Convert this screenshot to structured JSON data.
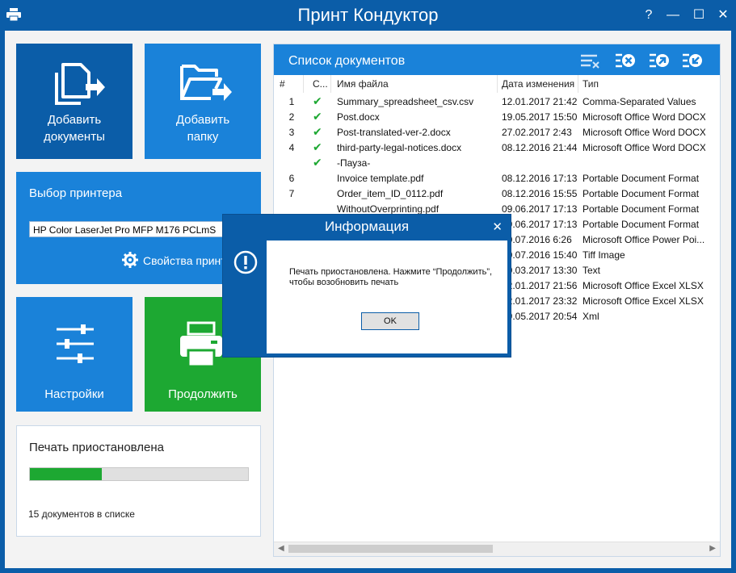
{
  "window": {
    "title": "Принт Кондуктор",
    "help_label": "?",
    "min_label": "—",
    "max_label": "☐",
    "close_label": "✕"
  },
  "tiles": {
    "add_documents": "Добавить документы",
    "add_documents_line1": "Добавить",
    "add_documents_line2": "документы",
    "add_folder_line1": "Добавить",
    "add_folder_line2": "папку",
    "settings": "Настройки",
    "continue": "Продолжить"
  },
  "printer": {
    "title": "Выбор принтера",
    "selected": "HP Color LaserJet Pro MFP M176 PCLmS",
    "properties_label": "Свойства принтера"
  },
  "status": {
    "title": "Печать приостановлена",
    "progress_percent": 33,
    "count_text": "15 документов в списке"
  },
  "doclist": {
    "title": "Список документов",
    "columns": {
      "num": "#",
      "status": "С...",
      "name": "Имя файла",
      "date": "Дата изменения",
      "type": "Тип"
    },
    "rows": [
      {
        "num": "1",
        "check": "✔",
        "name": "Summary_spreadsheet_csv.csv",
        "date": "12.01.2017 21:42",
        "type": "Comma-Separated Values"
      },
      {
        "num": "2",
        "check": "✔",
        "name": "Post.docx",
        "date": "19.05.2017 15:50",
        "type": "Microsoft Office Word DOCX"
      },
      {
        "num": "3",
        "check": "✔",
        "name": "Post-translated-ver-2.docx",
        "date": "27.02.2017 2:43",
        "type": "Microsoft Office Word DOCX"
      },
      {
        "num": "4",
        "check": "✔",
        "name": "third-party-legal-notices.docx",
        "date": "08.12.2016 21:44",
        "type": "Microsoft Office Word DOCX"
      },
      {
        "num": "",
        "check": "✔",
        "name": "-Пауза-",
        "date": "",
        "type": ""
      },
      {
        "num": "6",
        "check": "",
        "name": "Invoice template.pdf",
        "date": "08.12.2016 17:13",
        "type": "Portable Document Format"
      },
      {
        "num": "7",
        "check": "",
        "name": "Order_item_ID_0112.pdf",
        "date": "08.12.2016 15:55",
        "type": "Portable Document Format"
      },
      {
        "num": "",
        "check": "",
        "name": "WithoutOverprinting.pdf",
        "date": "09.06.2017 17:13",
        "type": "Portable Document Format"
      },
      {
        "num": "",
        "check": "",
        "name": "",
        "date": "09.06.2017 17:13",
        "type": "Portable Document Format"
      },
      {
        "num": "",
        "check": "",
        "name": "",
        "date": "10.07.2016 6:26",
        "type": "Microsoft Office Power Poi..."
      },
      {
        "num": "",
        "check": "",
        "name": "",
        "date": "10.07.2016 15:40",
        "type": "Tiff Image"
      },
      {
        "num": "",
        "check": "",
        "name": "",
        "date": "10.03.2017 13:30",
        "type": "Text"
      },
      {
        "num": "",
        "check": "",
        "name": "",
        "date": "12.01.2017 21:56",
        "type": "Microsoft Office Excel XLSX"
      },
      {
        "num": "",
        "check": "",
        "name": "",
        "date": "12.01.2017 23:32",
        "type": "Microsoft Office Excel XLSX"
      },
      {
        "num": "",
        "check": "",
        "name": "",
        "date": "19.05.2017 20:54",
        "type": "Xml"
      }
    ]
  },
  "dialog": {
    "title": "Информация",
    "close_label": "✕",
    "message": "Печать приостановлена. Нажмите “Продолжить”, чтобы возобновить печать",
    "ok_label": "OK"
  }
}
